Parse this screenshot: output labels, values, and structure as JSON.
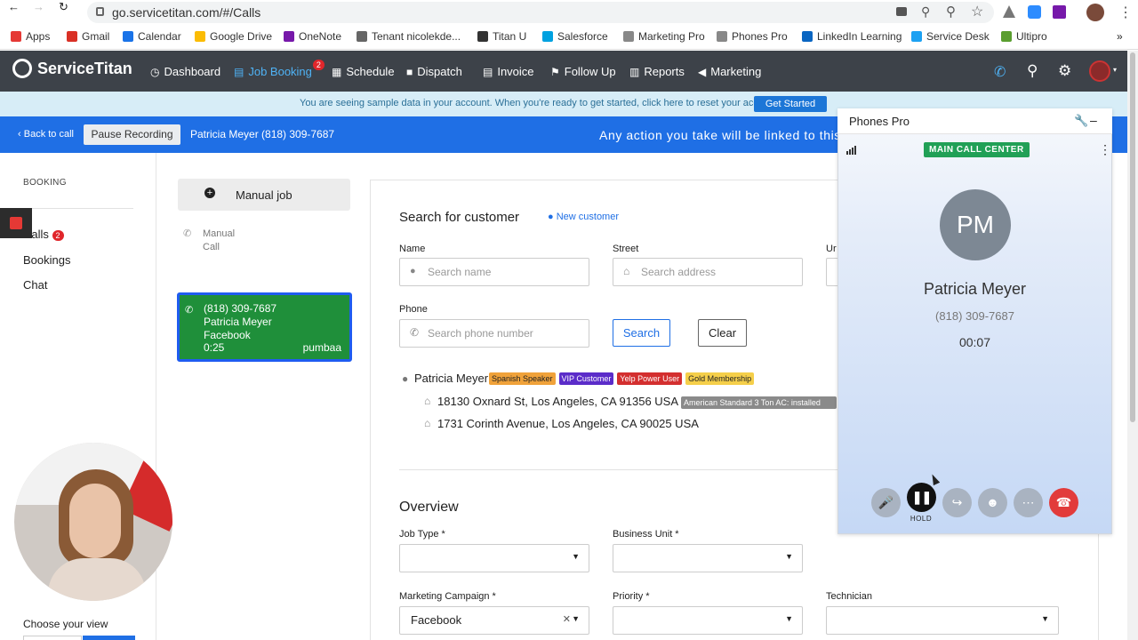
{
  "browser": {
    "url": "go.servicetitan.com/#/Calls",
    "bookmarks": [
      {
        "label": "Apps",
        "color": "#e53935"
      },
      {
        "label": "Gmail",
        "color": "#d93025"
      },
      {
        "label": "Calendar",
        "color": "#1a73e8"
      },
      {
        "label": "Google Drive",
        "color": "#fbbc04"
      },
      {
        "label": "OneNote",
        "color": "#7719aa"
      },
      {
        "label": "Tenant nicolekde...",
        "color": "#666666"
      },
      {
        "label": "Titan U",
        "color": "#333333"
      },
      {
        "label": "Salesforce",
        "color": "#00a1e0"
      },
      {
        "label": "Marketing Pro",
        "color": "#888888"
      },
      {
        "label": "Phones Pro",
        "color": "#888888"
      },
      {
        "label": "LinkedIn Learning",
        "color": "#0a66c2"
      },
      {
        "label": "Service Desk",
        "color": "#1da1f2"
      },
      {
        "label": "Ultipro",
        "color": "#5a9e2f"
      }
    ],
    "more": "»"
  },
  "nav": {
    "brand": "ServiceTitan",
    "items": [
      {
        "label": "Dashboard",
        "icon": "dashboard-icon"
      },
      {
        "label": "Job Booking",
        "icon": "briefcase-icon",
        "badge": "2"
      },
      {
        "label": "Schedule",
        "icon": "calendar-icon"
      },
      {
        "label": "Dispatch",
        "icon": "truck-icon"
      },
      {
        "label": "Invoice",
        "icon": "invoice-icon"
      },
      {
        "label": "Follow Up",
        "icon": "flag-icon"
      },
      {
        "label": "Reports",
        "icon": "reports-icon"
      },
      {
        "label": "Marketing",
        "icon": "megaphone-icon"
      }
    ]
  },
  "banner": {
    "text": "You are seeing sample data in your account. When you're ready to get started, click here to reset your account.",
    "button": "Get Started"
  },
  "callbar": {
    "back": "Back to call",
    "pause": "Pause Recording",
    "caller": "Patricia Meyer (818) 309-7687",
    "notice": "Any action you take will be linked to this"
  },
  "sidebar": {
    "title": "BOOKING",
    "links": [
      {
        "label": "Calls",
        "badge": "2"
      },
      {
        "label": "Bookings"
      },
      {
        "label": "Chat"
      }
    ],
    "choose_view": "Choose your view"
  },
  "calls": {
    "manual_job": "Manual job",
    "manual_call": [
      "Manual",
      "Call"
    ],
    "active": {
      "phone": "(818) 309-7687",
      "name": "Patricia Meyer",
      "source": "Facebook",
      "duration": "0:25",
      "agent": "pumbaa"
    }
  },
  "search": {
    "title": "Search for customer",
    "new_customer": "New customer",
    "name_label": "Name",
    "name_placeholder": "Search name",
    "street_label": "Street",
    "street_placeholder": "Search address",
    "unit_label": "Ur",
    "phone_label": "Phone",
    "phone_placeholder": "Search phone number",
    "search_btn": "Search",
    "clear_btn": "Clear"
  },
  "result": {
    "name": "Patricia Meyer",
    "tags": [
      {
        "label": "Spanish Speaker",
        "bg": "#f0a23a",
        "fg": "#222"
      },
      {
        "label": "VIP Customer",
        "bg": "#5b2cc9",
        "fg": "#fff"
      },
      {
        "label": "Yelp Power User",
        "bg": "#d32f2f",
        "fg": "#fff"
      },
      {
        "label": "Gold Membership",
        "bg": "#f5cf4a",
        "fg": "#222"
      }
    ],
    "addresses": [
      {
        "text": "18130 Oxnard St, Los Angeles, CA 91356 USA",
        "tag": "American Standard 3 Ton AC: installed"
      },
      {
        "text": "1731 Corinth Avenue, Los Angeles, CA 90025 USA"
      }
    ]
  },
  "overview": {
    "title": "Overview",
    "job_type": "Job Type *",
    "business_unit": "Business Unit *",
    "marketing_campaign": "Marketing Campaign *",
    "campaign_value": "Facebook",
    "priority": "Priority *",
    "technician": "Technician"
  },
  "phones": {
    "title": "Phones Pro",
    "queue": "MAIN CALL CENTER",
    "initials": "PM",
    "name": "Patricia Meyer",
    "number": "(818) 309-7687",
    "timer": "00:07",
    "hold_label": "HOLD"
  }
}
